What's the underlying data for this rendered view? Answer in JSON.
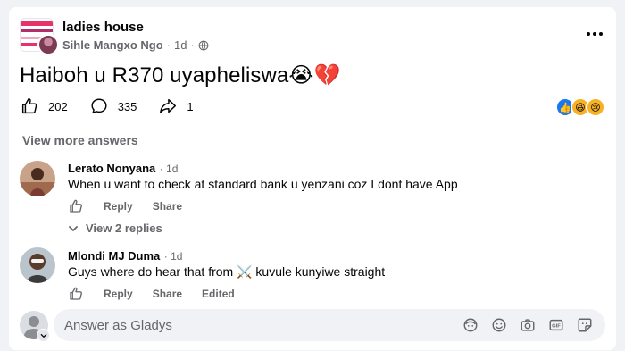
{
  "post": {
    "group_name": "ladies house",
    "author": "Sihle Mangxo Ngo",
    "time": "1d",
    "text": "Haiboh u R370 uyapheliswa😭💔",
    "likes": "202",
    "comments": "335",
    "shares": "1"
  },
  "view_more": "View more answers",
  "comments": [
    {
      "name": "Lerato Nonyana",
      "time": "1d",
      "text": "When u want to check at standard bank u yenzani coz I dont have App",
      "reply": "Reply",
      "share": "Share",
      "view_replies": "View 2 replies"
    },
    {
      "name": "Mlondi MJ Duma",
      "time": "1d",
      "text": "Guys where do hear that from ⚔️ kuvule kunyiwe straight",
      "reply": "Reply",
      "share": "Share",
      "edited": "Edited"
    }
  ],
  "composer": {
    "placeholder": "Answer as Gladys"
  },
  "colors": {
    "accent": "#1877f2",
    "secondary_text": "#65676b",
    "background": "#f0f2f5"
  },
  "icons": [
    "globe-icon",
    "more-icon",
    "like-icon",
    "comment-icon",
    "share-icon",
    "chevron-down-icon",
    "avatar-sticker-icon",
    "emoji-icon",
    "camera-icon",
    "gif-icon",
    "sticker-icon"
  ]
}
